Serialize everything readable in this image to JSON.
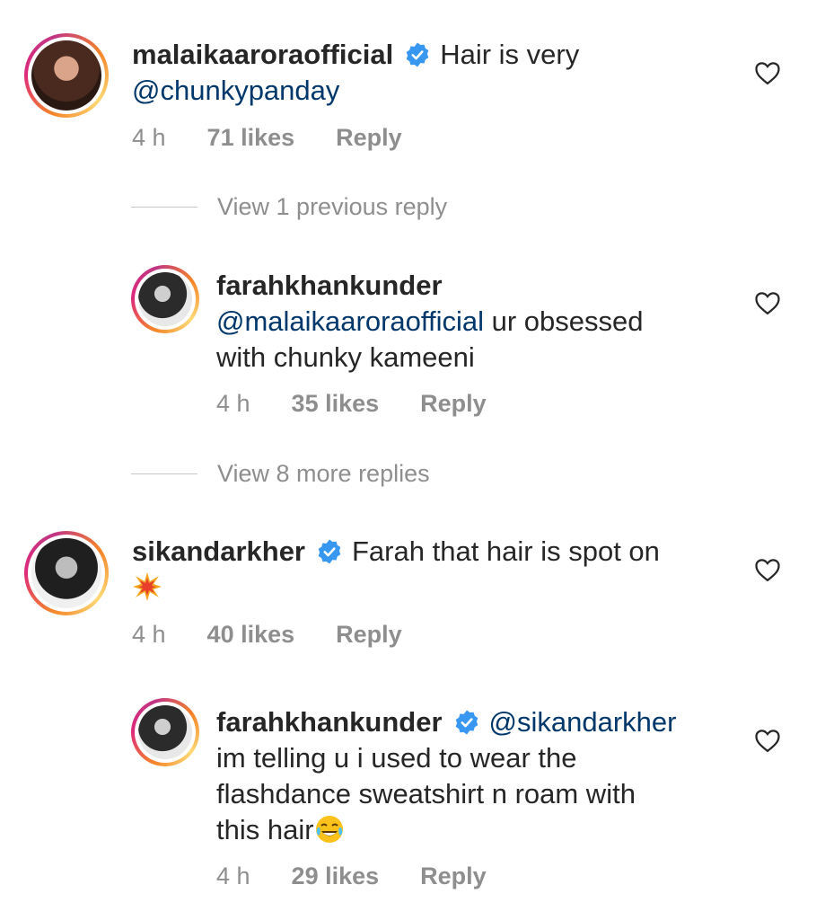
{
  "comments": [
    {
      "username": "malaikaaroraofficial",
      "verified": true,
      "text_line1": "Hair is very",
      "text_line2": "@chunkypanday",
      "time": "4 h",
      "likes": "71 likes",
      "reply": "Reply"
    },
    {
      "view_more": "View 1 previous reply"
    },
    {
      "username": "farahkhankunder",
      "verified": false,
      "mention": "@malaikaaroraofficial",
      "text_line1_rest": " ur obsessed",
      "text_line2": "with chunky kameeni",
      "time": "4 h",
      "likes": "35 likes",
      "reply": "Reply"
    },
    {
      "view_more": "View 8 more replies"
    },
    {
      "username": "sikandarkher",
      "verified": true,
      "text_line1": "Farah that hair is spot on",
      "emoji": "collision-emoji",
      "time": "4 h",
      "likes": "40 likes",
      "reply": "Reply"
    },
    {
      "username": "farahkhankunder",
      "verified": true,
      "mention": "@sikandarkher",
      "text_line2": "im telling u i used to wear the",
      "text_line3": "flashdance sweatshirt n roam with",
      "text_line4": "this hair",
      "emoji": "tears-of-joy-emoji",
      "time": "4 h",
      "likes": "29 likes",
      "reply": "Reply"
    }
  ],
  "colors": {
    "text": "#262626",
    "meta": "#8e8e8e",
    "mention": "#00376b",
    "verified": "#3897f0"
  },
  "icons": [
    "heart-icon",
    "verified-badge-icon"
  ]
}
